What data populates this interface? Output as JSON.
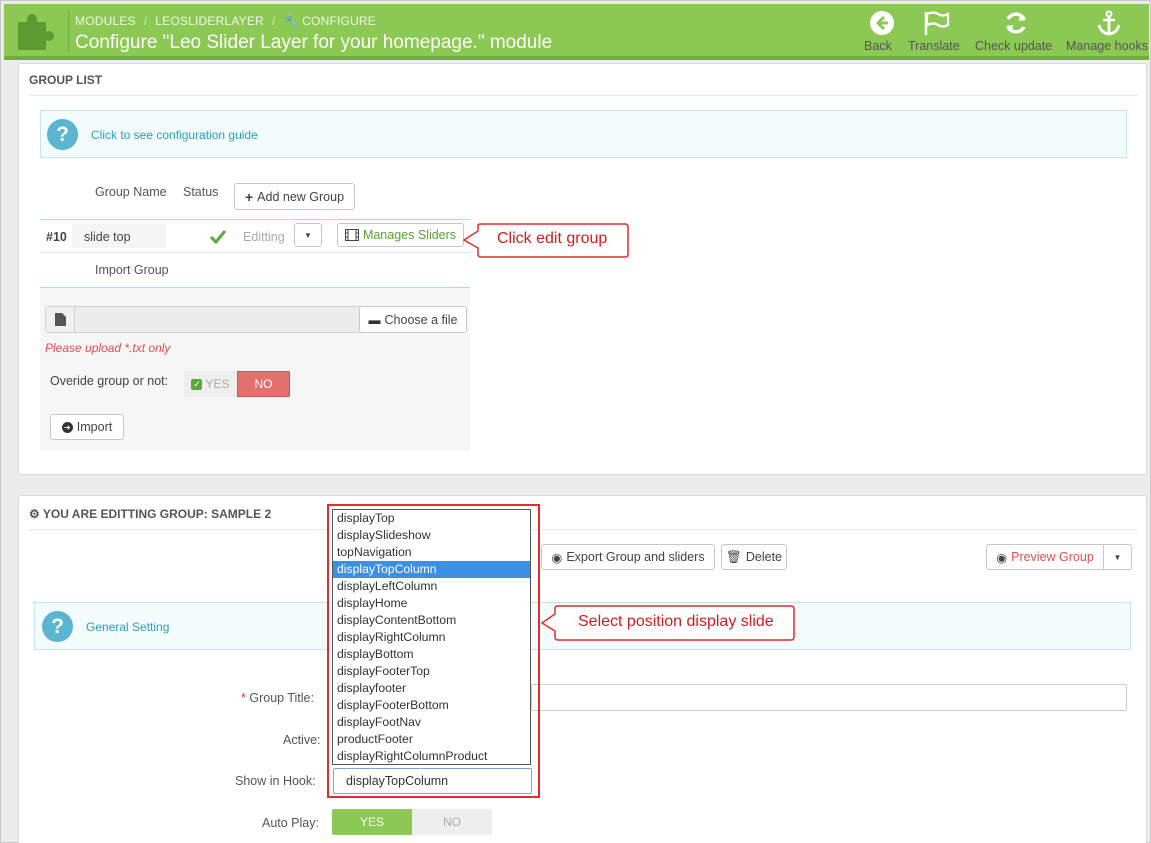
{
  "header": {
    "breadcrumb": [
      "MODULES",
      "LEOSLIDERLAYER",
      "CONFIGURE"
    ],
    "title": "Configure \"Leo Slider Layer for your homepage.\" module",
    "toolbar": [
      {
        "label": "Back",
        "icon": "back-arrow-icon"
      },
      {
        "label": "Translate",
        "icon": "flag-icon"
      },
      {
        "label": "Check update",
        "icon": "refresh-icon"
      },
      {
        "label": "Manage hooks",
        "icon": "anchor-icon"
      }
    ]
  },
  "group_list": {
    "heading": "GROUP LIST",
    "guide_link": "Click to see configuration guide",
    "col_group_name": "Group Name",
    "col_status": "Status",
    "add_button": "Add new Group",
    "row": {
      "id": "#10",
      "name": "slide top",
      "action": "Editting",
      "manage": "Manages Sliders"
    },
    "import_label": "Import Group",
    "choose_file": "Choose a file",
    "upload_note": "Please upload *.txt only",
    "override_label": "Overide group or not:",
    "toggle_yes": "YES",
    "toggle_no": "NO",
    "import_button": "Import"
  },
  "callouts": {
    "edit_group": "Click edit group",
    "position": "Select position display slide"
  },
  "editing": {
    "heading": "YOU ARE EDITTING GROUP: SAMPLE 2",
    "export_button": "Export Group and sliders",
    "delete_button": "Delete",
    "preview_button": "Preview Group",
    "general_link": "General Setting",
    "required_mark": "*",
    "group_title_label": "Group Title:",
    "active_label": "Active:",
    "show_in_hook_label": "Show in Hook:",
    "hook_value": "displayTopColumn",
    "auto_play_label": "Auto Play:",
    "auto_yes": "YES",
    "auto_no": "NO"
  },
  "hook_options": [
    "displayTop",
    "displaySlideshow",
    "topNavigation",
    "displayTopColumn",
    "displayLeftColumn",
    "displayHome",
    "displayContentBottom",
    "displayRightColumn",
    "displayBottom",
    "displayFooterTop",
    "displayfooter",
    "displayFooterBottom",
    "displayFootNav",
    "productFooter",
    "displayRightColumnProduct"
  ],
  "hook_selected_index": 3,
  "colors": {
    "header_green": "#8bc954",
    "accent_blue": "#2a9fbd",
    "danger": "#e36f6f",
    "callout_red": "#e02d2d",
    "select_blue": "#3d8fe4"
  }
}
